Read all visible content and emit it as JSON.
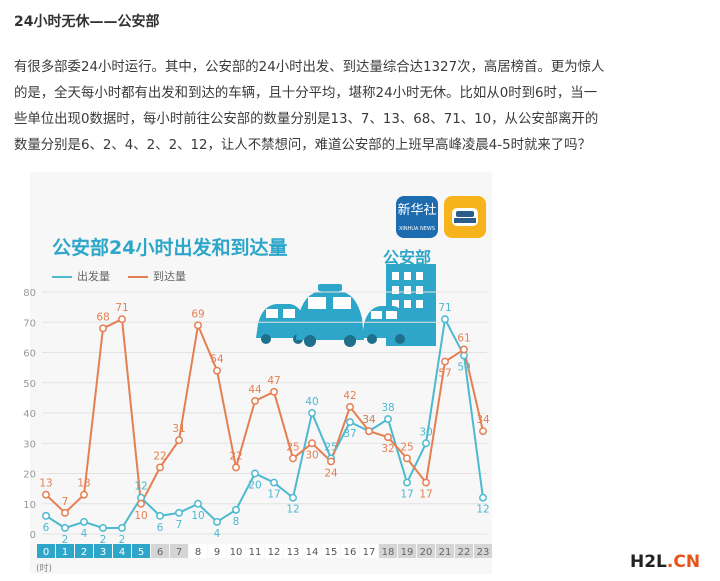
{
  "article": {
    "heading": "24小时无休——公安部",
    "paragraph_lines": [
      "有很多部委24小时运行。其中，公安部的24小时出发、到达量综合达1327次，高居榜首。更为惊人",
      "的是，全天每小时都有出发和到达的车辆，且十分平均，堪称24小时无休。比如从0时到6时，当一",
      "些单位出现0数据时，每小时前往公安部的数量分别是13、7、13、68、71、10，从公安部离开的",
      "数量分别是6、2、4、2、2、12，让人不禁想问，难道公安部的上班早高峰凌晨4-5时就来了吗？"
    ]
  },
  "infographic": {
    "badge_label": "公安部",
    "xinhua_logo_text": "新华社",
    "xinhua_logo_subtext": "XINHUA NEWS",
    "icons": [
      "xinhua-app-icon",
      "taxi-app-icon",
      "police-building-icon",
      "car-icon",
      "taxi-icon",
      "car-icon"
    ]
  },
  "watermark": {
    "part1": "H2L",
    "part2": ".CN"
  },
  "colors": {
    "departure": "#4db9d0",
    "arrival": "#e57f52",
    "title": "#2ea6c9",
    "highlight": "#2ea6c9"
  },
  "chart_data": {
    "type": "line",
    "title": "公安部24小时出发和到达量",
    "xlabel": "(时)",
    "ylabel": "",
    "ylim": [
      0,
      80
    ],
    "yticks": [
      0,
      10,
      20,
      30,
      40,
      50,
      60,
      70,
      80
    ],
    "categories": [
      "0",
      "1",
      "2",
      "3",
      "4",
      "5",
      "6",
      "7",
      "8",
      "9",
      "10",
      "11",
      "12",
      "13",
      "14",
      "15",
      "16",
      "17",
      "18",
      "19",
      "20",
      "21",
      "22",
      "23"
    ],
    "highlighted_hours": [
      "0",
      "1",
      "2",
      "3",
      "4",
      "5"
    ],
    "grey_hours": [
      "6",
      "7",
      "18",
      "19",
      "20",
      "21",
      "22",
      "23"
    ],
    "series": [
      {
        "name": "出发量",
        "values": [
          6,
          2,
          4,
          2,
          2,
          12,
          6,
          7,
          10,
          4,
          8,
          20,
          17,
          12,
          40,
          25,
          37,
          34,
          38,
          17,
          30,
          71,
          59,
          12
        ]
      },
      {
        "name": "到达量",
        "values": [
          13,
          7,
          13,
          68,
          71,
          10,
          22,
          31,
          69,
          54,
          22,
          44,
          47,
          25,
          30,
          24,
          42,
          34,
          32,
          25,
          17,
          57,
          61,
          34
        ]
      }
    ],
    "grid": true,
    "legend_position": "top-left"
  }
}
